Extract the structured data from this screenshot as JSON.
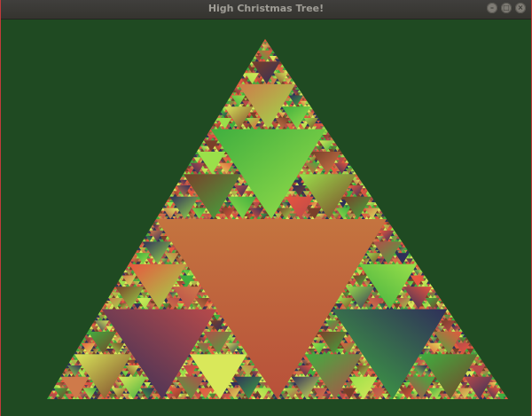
{
  "window": {
    "title": "High Christmas Tree!",
    "controls": {
      "minimize_glyph": "–",
      "maximize_glyph": "□",
      "close_glyph": "×"
    }
  },
  "colors": {
    "background": "#1f4a22",
    "fractal_palette": [
      "#e8553f",
      "#b84a4a",
      "#7a3f2a",
      "#3fae3f",
      "#9ae04a",
      "#d9e85a",
      "#2f2f5a",
      "#cf7a4a"
    ]
  },
  "fractal": {
    "type": "sierpinski-triangle",
    "recursion_depth": 6
  }
}
